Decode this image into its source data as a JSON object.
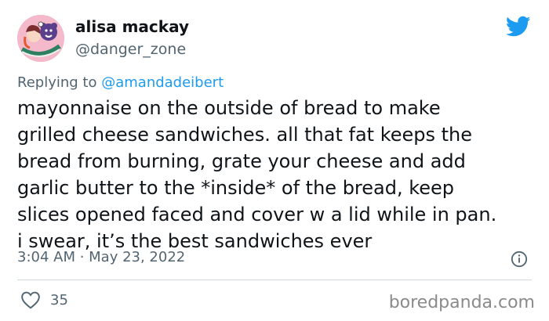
{
  "author": {
    "display_name": "alisa mackay",
    "handle": "@danger_zone"
  },
  "reply": {
    "prefix": "Replying to",
    "target": "@amandadeibert"
  },
  "tweet": {
    "lines": [
      "mayonnaise on the outside of bread to make",
      "grilled cheese sandwiches. all that fat keeps the",
      "bread from burning, grate your cheese and add",
      "garlic butter to the *inside* of the bread, keep",
      "slices opened faced and cover w a lid while in pan.",
      "i swear, it’s the best sandwiches ever"
    ],
    "timestamp": "3:04 AM · May 23, 2022"
  },
  "engagement": {
    "likes": "35"
  },
  "watermark": "boredpanda.com",
  "icons": {
    "brand": "twitter-bird-icon",
    "info": "info-icon",
    "like": "heart-icon"
  },
  "colors": {
    "twitter_blue": "#1d9bf0",
    "text": "#0f1419",
    "secondary": "#536471",
    "divider": "#cfd9de"
  }
}
